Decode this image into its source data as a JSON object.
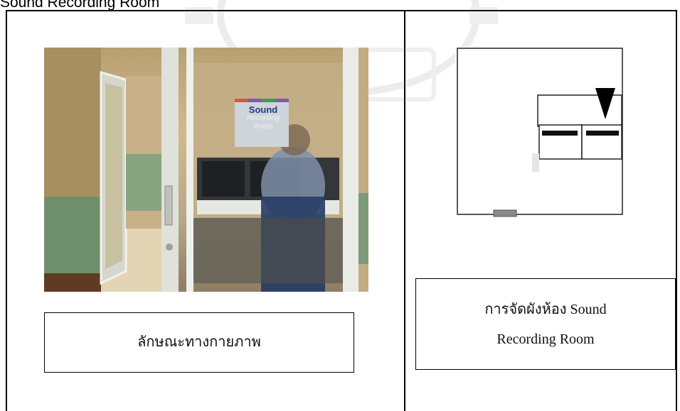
{
  "heading": {
    "text": "Sound Recording Room"
  },
  "photo": {
    "sign_title": "Sound",
    "sign_subtitle_line1": "Recording",
    "sign_subtitle_line2": "Room",
    "colors": {
      "wall": "#cdb68a",
      "frame": "#d9dcd6",
      "panel": "#7d9e7c",
      "floor": "#e2d6b8"
    }
  },
  "captions": {
    "left": "ลักษณะทางกายภาพ",
    "right_line1": "การจัดผังห้อง Sound",
    "right_line2": "Recording Room"
  }
}
